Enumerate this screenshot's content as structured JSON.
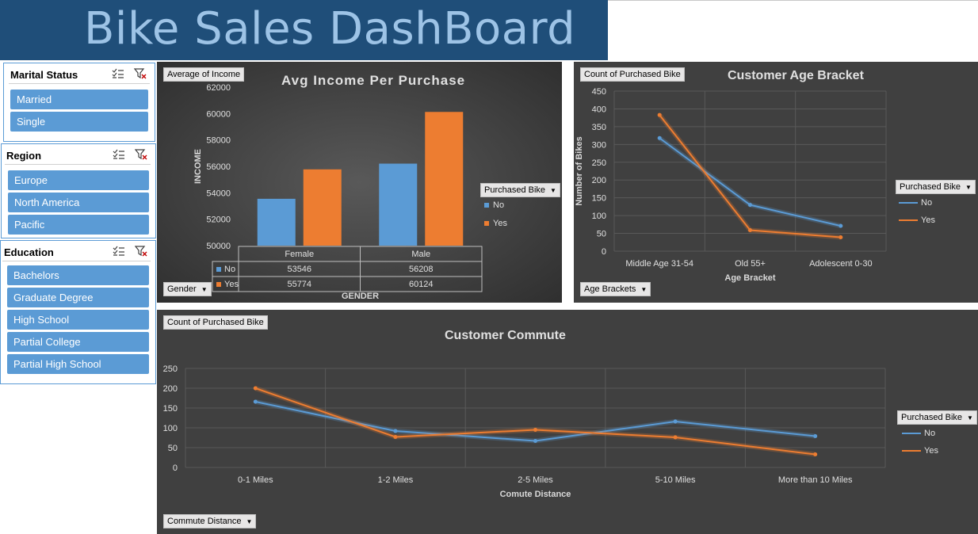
{
  "banner": {
    "title": "Bike Sales DashBoard"
  },
  "slicers": {
    "marital": {
      "title": "Marital Status",
      "items": [
        "Married",
        "Single"
      ]
    },
    "region": {
      "title": "Region",
      "items": [
        "Europe",
        "North America",
        "Pacific"
      ]
    },
    "education": {
      "title": "Education",
      "items": [
        "Bachelors",
        "Graduate Degree",
        "High School",
        "Partial College",
        "Partial High School"
      ]
    }
  },
  "icons": {
    "multiselect": "multi-select-icon",
    "clear_filter": "clear-filter-icon",
    "dropdown": "dropdown-arrow-icon"
  },
  "colors": {
    "no": "#5b9bd5",
    "yes": "#ed7d31",
    "slicer_item": "#5b9bd5",
    "banner": "#1f4e79",
    "panel": "#404040"
  },
  "chart_data": [
    {
      "type": "bar",
      "title": "Avg Income Per Purchase",
      "field_button": "Average of Income",
      "axis_button": "Gender",
      "legend_button": "Purchased Bike",
      "xlabel": "GENDER",
      "ylabel": "INCOME",
      "ylim": [
        50000,
        62000
      ],
      "yticks": [
        "50000",
        "52000",
        "54000",
        "56000",
        "58000",
        "60000",
        "62000"
      ],
      "categories": [
        "Female",
        "Male"
      ],
      "series": [
        {
          "name": "No",
          "values": [
            53546,
            56208
          ]
        },
        {
          "name": "Yes",
          "values": [
            55774,
            60124
          ]
        }
      ],
      "data_table": true,
      "legend": "right"
    },
    {
      "type": "line",
      "title": "Customer Age Bracket",
      "field_button": "Count of Purchased Bike",
      "axis_button": "Age Brackets",
      "legend_button": "Purchased Bike",
      "xlabel": "Age Bracket",
      "ylabel": "Number of Bikes",
      "ylim": [
        0,
        450
      ],
      "yticks": [
        "0",
        "50",
        "100",
        "150",
        "200",
        "250",
        "300",
        "350",
        "400",
        "450"
      ],
      "categories": [
        "Middle Age 31-54",
        "Old 55+",
        "Adolescent 0-30"
      ],
      "series": [
        {
          "name": "No",
          "values": [
            318,
            130,
            71
          ]
        },
        {
          "name": "Yes",
          "values": [
            383,
            59,
            39
          ]
        }
      ],
      "grid": true,
      "legend": "right"
    },
    {
      "type": "line",
      "title": "Customer Commute",
      "field_button": "Count of Purchased Bike",
      "axis_button": "Commute Distance",
      "legend_button": "Purchased Bike",
      "xlabel": "Comute Distance",
      "ylabel": "",
      "ylim": [
        0,
        250
      ],
      "yticks": [
        "0",
        "50",
        "100",
        "150",
        "200",
        "250"
      ],
      "categories": [
        "0-1 Miles",
        "1-2 Miles",
        "2-5 Miles",
        "5-10 Miles",
        "More than 10 Miles"
      ],
      "series": [
        {
          "name": "No",
          "values": [
            166,
            92,
            67,
            116,
            79
          ]
        },
        {
          "name": "Yes",
          "values": [
            200,
            77,
            95,
            76,
            33
          ]
        }
      ],
      "grid": true,
      "legend": "right"
    }
  ]
}
